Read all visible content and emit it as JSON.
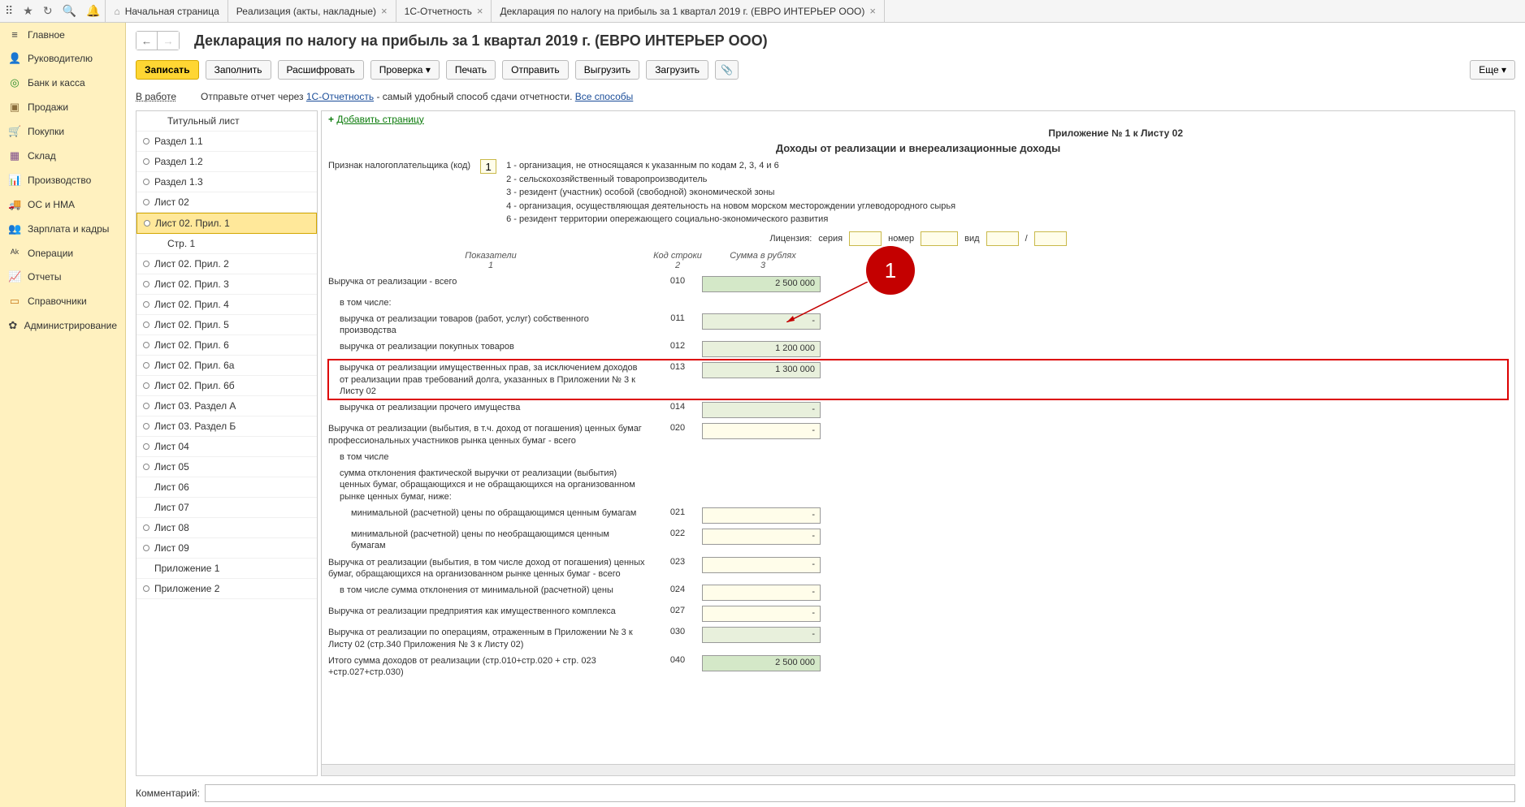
{
  "tabs": [
    {
      "label": "Начальная страница",
      "home": true
    },
    {
      "label": "Реализация (акты, накладные)",
      "close": true
    },
    {
      "label": "1С-Отчетность",
      "close": true
    },
    {
      "label": "Декларация по налогу на прибыль за 1 квартал 2019 г. (ЕВРО ИНТЕРЬЕР ООО)",
      "close": true
    }
  ],
  "leftnav": [
    {
      "icon": "≡",
      "label": "Главное",
      "cls": "dark"
    },
    {
      "icon": "👤",
      "label": "Руководителю",
      "cls": "orange"
    },
    {
      "icon": "◎",
      "label": "Банк и касса",
      "cls": "green"
    },
    {
      "icon": "▣",
      "label": "Продажи",
      "cls": "brown"
    },
    {
      "icon": "🛒",
      "label": "Покупки",
      "cls": "blue"
    },
    {
      "icon": "▦",
      "label": "Склад",
      "cls": "purple"
    },
    {
      "icon": "📊",
      "label": "Производство",
      "cls": "dark"
    },
    {
      "icon": "🚚",
      "label": "ОС и НМА",
      "cls": "dark"
    },
    {
      "icon": "👥",
      "label": "Зарплата и кадры",
      "cls": "orange"
    },
    {
      "icon": "ᴬᵏ",
      "label": "Операции",
      "cls": "dark"
    },
    {
      "icon": "📈",
      "label": "Отчеты",
      "cls": "blue"
    },
    {
      "icon": "▭",
      "label": "Справочники",
      "cls": "orange"
    },
    {
      "icon": "✿",
      "label": "Администрирование",
      "cls": "dark"
    }
  ],
  "page": {
    "title": "Декларация по налогу на прибыль за 1 квартал 2019 г. (ЕВРО ИНТЕРЬЕР ООО)",
    "status": "В работе",
    "hint_pre": "Отправьте отчет через ",
    "hint_link1": "1С-Отчетность",
    "hint_mid": " - самый удобный способ сдачи отчетности. ",
    "hint_link2": "Все способы"
  },
  "toolbar": {
    "save": "Записать",
    "fill": "Заполнить",
    "decode": "Расшифровать",
    "check": "Проверка",
    "print": "Печать",
    "send": "Отправить",
    "export": "Выгрузить",
    "import": "Загрузить",
    "more": "Еще",
    "attach": "📎"
  },
  "tree": [
    {
      "label": "Титульный лист",
      "leaf": true,
      "ind": 1
    },
    {
      "label": "Раздел 1.1"
    },
    {
      "label": "Раздел 1.2"
    },
    {
      "label": "Раздел 1.3"
    },
    {
      "label": "Лист 02"
    },
    {
      "label": "Лист 02. Прил. 1",
      "sel": true
    },
    {
      "label": "Стр. 1",
      "leaf": true,
      "ind": 1
    },
    {
      "label": "Лист 02. Прил. 2"
    },
    {
      "label": "Лист 02. Прил. 3"
    },
    {
      "label": "Лист 02. Прил. 4"
    },
    {
      "label": "Лист 02. Прил. 5"
    },
    {
      "label": "Лист 02. Прил. 6"
    },
    {
      "label": "Лист 02. Прил. 6а"
    },
    {
      "label": "Лист 02. Прил. 6б"
    },
    {
      "label": "Лист 03. Раздел А"
    },
    {
      "label": "Лист 03. Раздел Б"
    },
    {
      "label": "Лист 04"
    },
    {
      "label": "Лист 05"
    },
    {
      "label": "Лист 06",
      "leaf": true
    },
    {
      "label": "Лист 07",
      "leaf": true
    },
    {
      "label": "Лист 08"
    },
    {
      "label": "Лист 09"
    },
    {
      "label": "Приложение 1",
      "leaf": true
    },
    {
      "label": "Приложение 2"
    }
  ],
  "form": {
    "add_page": "Добавить страницу",
    "app_title": "Приложение № 1 к Листу 02",
    "section_title": "Доходы от реализации и внереализационные доходы",
    "taxpayer_label": "Признак налогоплательщика (код)",
    "taxpayer_code": "1",
    "taxpayer_codes": [
      "1 - организация, не относящаяся к указанным по кодам 2, 3, 4 и 6",
      "2 - сельскохозяйственный товаропроизводитель",
      "3 - резидент (участник) особой (свободной) экономической зоны",
      "4 - организация, осуществляющая деятельность на новом морском месторождении углеводородного сырья",
      "6 - резидент территории опережающего социально-экономического развития"
    ],
    "license": {
      "label": "Лицензия:",
      "series": "серия",
      "number": "номер",
      "type": "вид",
      "sep": "/"
    },
    "headers": {
      "c1": "Показатели",
      "c1s": "1",
      "c2": "Код строки",
      "c2s": "2",
      "c3": "Сумма в рублях",
      "c3s": "3"
    },
    "rows": [
      {
        "lbl": "Выручка от реализации - всего",
        "code": "010",
        "val": "2 500 000",
        "style": "green"
      },
      {
        "lbl": "в том числе:",
        "code": "",
        "val": null,
        "ind": 1
      },
      {
        "lbl": "выручка от реализации товаров (работ, услуг) собственного производства",
        "code": "011",
        "val": "-",
        "style": "lgreen",
        "ind": 1
      },
      {
        "lbl": "выручка от реализации покупных товаров",
        "code": "012",
        "val": "1 200 000",
        "style": "lgreen",
        "ind": 1
      },
      {
        "lbl": "выручка от реализации имущественных прав, за исключением доходов от реализации прав требований долга, указанных в Приложении № 3 к Листу 02",
        "code": "013",
        "val": "1 300 000",
        "style": "lgreen",
        "ind": 1,
        "hl": true
      },
      {
        "lbl": "выручка от реализации прочего имущества",
        "code": "014",
        "val": "-",
        "style": "lgreen",
        "ind": 1
      },
      {
        "lbl": "Выручка от реализации (выбытия, в т.ч. доход от погашения) ценных бумаг профессиональных участников рынка ценных бумаг - всего",
        "code": "020",
        "val": "-",
        "style": "yellow"
      },
      {
        "lbl": "в том числе",
        "code": "",
        "val": null,
        "ind": 1
      },
      {
        "lbl": "сумма отклонения фактической выручки от реализации (выбытия) ценных бумаг, обращающихся и не обращающихся на организованном рынке ценных бумаг, ниже:",
        "code": "",
        "val": null,
        "ind": 1
      },
      {
        "lbl": "минимальной (расчетной) цены по обращающимся ценным бумагам",
        "code": "021",
        "val": "-",
        "style": "yellow",
        "ind": 2
      },
      {
        "lbl": "минимальной (расчетной) цены по необращающимся ценным бумагам",
        "code": "022",
        "val": "-",
        "style": "yellow",
        "ind": 2
      },
      {
        "lbl": "Выручка от реализации (выбытия, в том числе доход от погашения) ценных бумаг, обращающихся на организованном рынке ценных бумаг - всего",
        "code": "023",
        "val": "-",
        "style": "yellow"
      },
      {
        "lbl": "в том числе сумма отклонения от минимальной (расчетной) цены",
        "code": "024",
        "val": "-",
        "style": "yellow",
        "ind": 1
      },
      {
        "lbl": "Выручка от реализации предприятия как имущественного комплекса",
        "code": "027",
        "val": "-",
        "style": "yellow"
      },
      {
        "lbl": "Выручка от реализации по операциям, отраженным в Приложении № 3 к Листу 02 (стр.340 Приложения № 3 к Листу 02)",
        "code": "030",
        "val": "-",
        "style": "lgreen"
      },
      {
        "lbl": "Итого сумма доходов от реализации (стр.010+стр.020 + стр. 023 +стр.027+стр.030)",
        "code": "040",
        "val": "2 500 000",
        "style": "green"
      }
    ]
  },
  "callout": "1",
  "comment": {
    "label": "Комментарий:"
  }
}
